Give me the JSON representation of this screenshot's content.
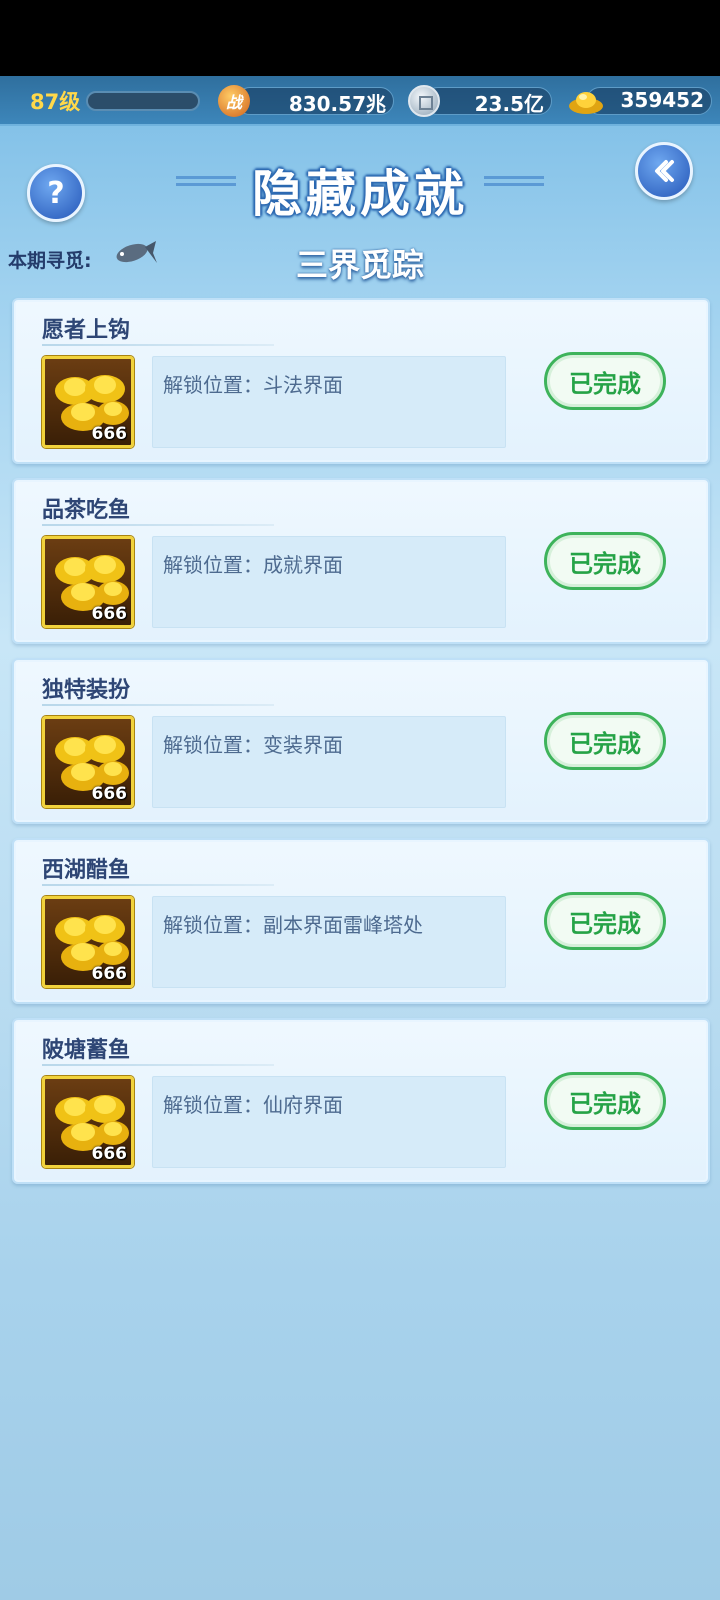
{
  "status": {
    "level": "87级",
    "battle_power": "830.57兆",
    "silver": "23.5亿",
    "gold": "359452"
  },
  "header": {
    "title": "隐藏成就",
    "period_label": "本期寻觅:",
    "period_value": "三界觅踪"
  },
  "achievements": [
    {
      "title": "愿者上钩",
      "reward_count": "666",
      "location": "解锁位置：斗法界面",
      "status": "已完成"
    },
    {
      "title": "品茶吃鱼",
      "reward_count": "666",
      "location": "解锁位置：成就界面",
      "status": "已完成"
    },
    {
      "title": "独特装扮",
      "reward_count": "666",
      "location": "解锁位置：变装界面",
      "status": "已完成"
    },
    {
      "title": "西湖醋鱼",
      "reward_count": "666",
      "location": "解锁位置：副本界面雷峰塔处",
      "status": "已完成"
    },
    {
      "title": "陂塘蓄鱼",
      "reward_count": "666",
      "location": "解锁位置：仙府界面",
      "status": "已完成"
    }
  ],
  "icons": {
    "help": "question-icon",
    "back": "back-arrow-icon",
    "battle": "battle-power-icon",
    "silver": "silver-coin-icon",
    "gold": "gold-ingot-icon",
    "fish": "fish-icon",
    "reward": "gold-ingot-pile-icon"
  },
  "colors": {
    "done_green": "#3eb35b",
    "title_blue": "#2e4675",
    "level_yellow": "#ffd84a"
  }
}
